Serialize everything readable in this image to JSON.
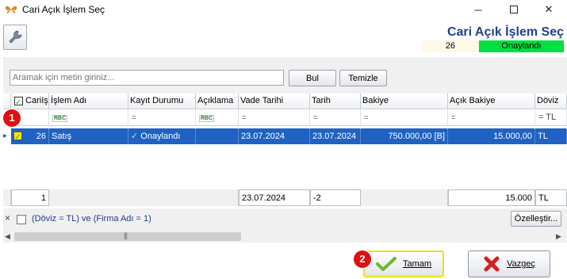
{
  "window": {
    "title": "Cari Açık İşlem Seç",
    "minimize_glyph": "─",
    "close_glyph": "✕"
  },
  "header": {
    "title": "Cari Açık İşlem Seç",
    "id_value": "26",
    "status_value": "Onaylandı",
    "status_color": "#00e040"
  },
  "search": {
    "placeholder": "Aramak için metin giriniz...",
    "find_label": "Bul",
    "clear_label": "Temizle"
  },
  "grid": {
    "columns": [
      "CariIş",
      "İşlem Adı",
      "Kayıt Durumu",
      "Açıklama",
      "Vade Tarihi",
      "Tarih",
      "Bakiye",
      "Açık Bakiye",
      "Döviz"
    ],
    "filter_row": {
      "abc": "RBC",
      "eq": "=",
      "doviz": "TL"
    },
    "row": {
      "cari_is": "26",
      "islem_adi": "Satış",
      "kayit_durumu": "Onaylandı",
      "aciklama": "",
      "vade_tarihi": "23.07.2024",
      "tarih": "23.07.2024",
      "bakiye": "750.000,00 [B]",
      "acik_bakiye": "15.000,00",
      "doviz": "TL"
    },
    "footer": {
      "count": "1",
      "vade_tarihi": "23.07.2024",
      "tarih": "-2",
      "acik_bakiye": "15.000",
      "doviz": "TL"
    },
    "selected_row_color": "#1f62c4"
  },
  "filter_bar": {
    "close_glyph": "×",
    "expression": "(Döviz = TL) ve (Firma Adı = 1)",
    "customize_label": "Özelleştir..."
  },
  "scroll": {
    "left_glyph": "◀",
    "right_glyph": "▶",
    "grip": "|||"
  },
  "actions": {
    "ok_label": "Tamam",
    "cancel_label": "Vazgeç"
  },
  "annotations": {
    "badge1": "1",
    "badge2": "2",
    "badge_color": "#e01010"
  }
}
